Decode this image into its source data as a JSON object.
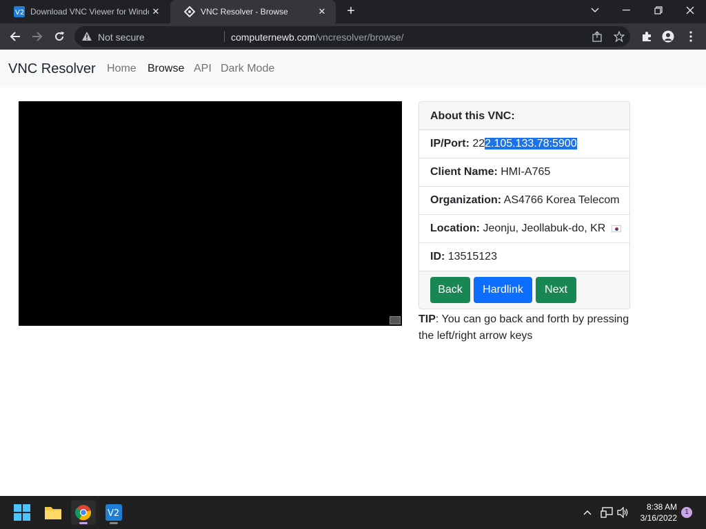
{
  "browser": {
    "tabs": [
      {
        "title": "Download VNC Viewer for Windo",
        "active": false
      },
      {
        "title": "VNC Resolver - Browse",
        "active": true
      }
    ],
    "omnibox": {
      "security_label": "Not secure",
      "url_host": "computernewb.com",
      "url_path": "/vncresolver/browse/"
    }
  },
  "navbar": {
    "brand": "VNC Resolver",
    "links": [
      "Home",
      "Browse",
      "API",
      "Dark Mode"
    ],
    "active_link": "Browse"
  },
  "card": {
    "header": "About this VNC:",
    "ip_label": "IP/Port:",
    "ip_prefix": "22",
    "ip_selected": "2.105.133.78:5900",
    "client_label": "Client Name:",
    "client_value": "HMI-A765",
    "org_label": "Organization:",
    "org_value": "AS4766 Korea Telecom",
    "location_label": "Location:",
    "location_value": "Jeonju, Jeollabuk-do, KR",
    "id_label": "ID:",
    "id_value": "13515123",
    "buttons": {
      "back": "Back",
      "hardlink": "Hardlink",
      "next": "Next"
    }
  },
  "tip": {
    "label": "TIP",
    "text": ": You can go back and forth by pressing the left/right arrow keys"
  },
  "taskbar": {
    "time": "8:38 AM",
    "date": "3/16/2022",
    "notifications": "1"
  },
  "colors": {
    "success": "#198754",
    "primary": "#0d6efd",
    "selection": "#1a73e8"
  }
}
